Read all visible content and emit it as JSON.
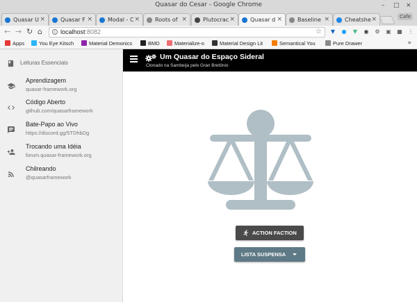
{
  "window": {
    "title": "Quasar do Cesar - Google Chrome",
    "controls": [
      "–",
      "□",
      "×"
    ]
  },
  "tabs": [
    {
      "label": "Quasar U",
      "icon": "quasar-icon",
      "color": "#1976d2"
    },
    {
      "label": "Quasar F",
      "icon": "quasar-icon",
      "color": "#1976d2"
    },
    {
      "label": "Modal - C",
      "icon": "quasar-icon",
      "color": "#1976d2"
    },
    {
      "label": "Roots of",
      "icon": "page-icon",
      "color": "#888888"
    },
    {
      "label": "Plutocrac",
      "icon": "biohazard-icon",
      "color": "#444444"
    },
    {
      "label": "Quasar d",
      "icon": "quasar-icon",
      "color": "#1976d2",
      "active": true
    },
    {
      "label": "Baseline",
      "icon": "page-icon",
      "color": "#888888"
    },
    {
      "label": "Cheatshe",
      "icon": "play-icon",
      "color": "#1e88e5"
    }
  ],
  "profile": "Cafe",
  "address_bar": {
    "host": "localhost",
    "port": ":8082"
  },
  "bookmarks": [
    {
      "label": "Apps",
      "icon": "apps-icon",
      "color": "#e53935"
    },
    {
      "label": "You Eye Kitsch",
      "icon": "drop-icon",
      "color": "#29b6f6"
    },
    {
      "label": "Material Demonics",
      "icon": "square-icon",
      "color": "#8e24aa"
    },
    {
      "label": "BMD",
      "icon": "b-icon",
      "color": "#222222"
    },
    {
      "label": "Materialize-o",
      "icon": "m-icon",
      "color": "#ee6e73"
    },
    {
      "label": "Material Design Lit",
      "icon": "circle-icon",
      "color": "#333333"
    },
    {
      "label": "Semantical You",
      "icon": "square-icon",
      "color": "#f57c00"
    },
    {
      "label": "Pure Drawer",
      "icon": "page-icon",
      "color": "#888888"
    }
  ],
  "sidebar": {
    "header": "Leituras Essenciais",
    "items": [
      {
        "title": "Aprendizagem",
        "subtitle": "quasar-framework.org",
        "icon": "school-icon"
      },
      {
        "title": "Código Aberto",
        "subtitle": "github.com/quasarframework",
        "icon": "code-icon"
      },
      {
        "title": "Bate-Papo ao Vivo",
        "subtitle": "https://discord.gg/5TDhbDg",
        "icon": "chat-icon"
      },
      {
        "title": "Trocando uma Idéia",
        "subtitle": "forum.quasar-framework.org",
        "icon": "forum-icon"
      },
      {
        "title": "Chilreando",
        "subtitle": "@quasarframework",
        "icon": "rss-icon"
      }
    ]
  },
  "header": {
    "title": "Um Quasar do Espaço Sideral",
    "subtitle": "Clonado na Sambeija pelo Gran Bretônio"
  },
  "main": {
    "illustration": "scale-icon",
    "action_button": "ACTION FACTION",
    "dropdown_button": "LISTA SUSPENSA"
  },
  "colors": {
    "header_bg": "#000000",
    "sidebar_bg": "#f0f0f0",
    "scale": "#b0bec5",
    "action_button": "#4a4a4a",
    "dropdown_button": "#5e7a86"
  }
}
